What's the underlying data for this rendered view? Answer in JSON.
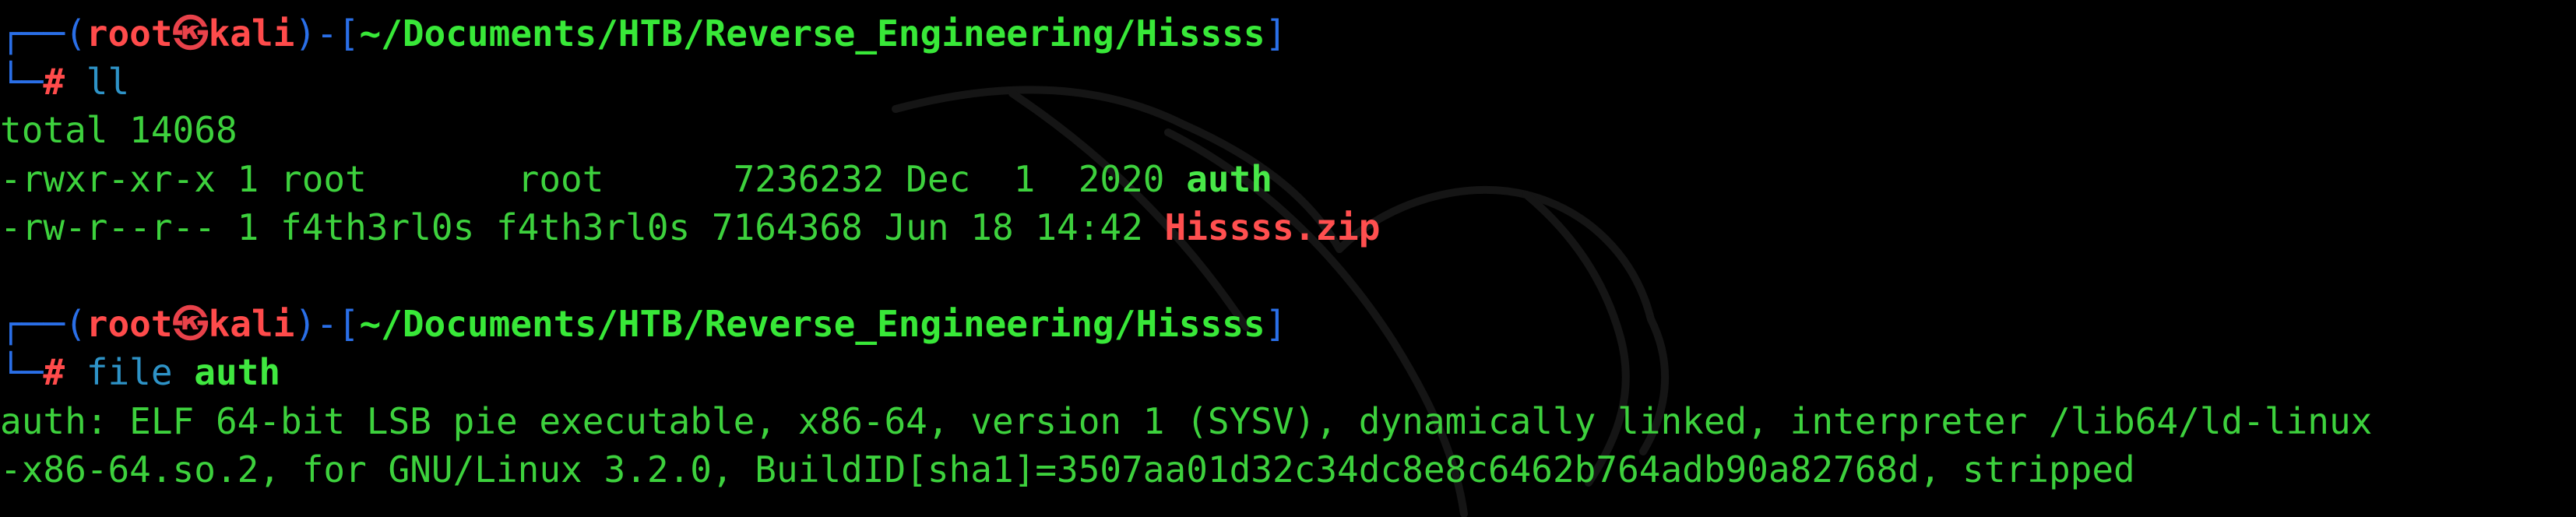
{
  "prompt": {
    "corner_top": "┌──",
    "open_paren": "(",
    "user": "root",
    "at_symbol": "㉿",
    "host": "kali",
    "close_paren_dash": ")-[",
    "path": "~/Documents/HTB/Reverse_Engineering/Hissss",
    "close_bracket": "]",
    "corner_bottom": "└─",
    "hash": "#"
  },
  "blocks": [
    {
      "command": "ll",
      "arg": "",
      "output": [
        {
          "prefix": "total 14068",
          "name": "",
          "kind": "plain"
        },
        {
          "prefix": "-rwxr-xr-x 1 root       root      7236232 Dec  1  2020 ",
          "name": "auth",
          "kind": "exec"
        },
        {
          "prefix": "-rw-r--r-- 1 f4th3rl0s f4th3rl0s 7164368 Jun 18 14:42 ",
          "name": "Hissss.zip",
          "kind": "zip"
        }
      ]
    },
    {
      "command": "file ",
      "arg": "auth",
      "output": [
        {
          "prefix": "auth: ELF 64-bit LSB pie executable, x86-64, version 1 (SYSV), dynamically linked, interpreter /lib64/ld-linux",
          "name": "",
          "kind": "plain"
        },
        {
          "prefix": "-x86-64.so.2, for GNU/Linux 3.2.0, BuildID[sha1]=3507aa01d32c34dc8e8c6462b764adb90a82768d, stripped",
          "name": "",
          "kind": "plain"
        }
      ]
    }
  ],
  "colors": {
    "background": "#000000",
    "output_green": "#3dd13d",
    "prompt_user_red": "#ff4b4b",
    "prompt_bracket_blue": "#2a6fe8",
    "path_green": "#38e838",
    "command_cyan": "#2e93c7",
    "zip_red": "#ff4f4f"
  },
  "icons": {
    "watermark": "kali-dragon-watermark"
  }
}
